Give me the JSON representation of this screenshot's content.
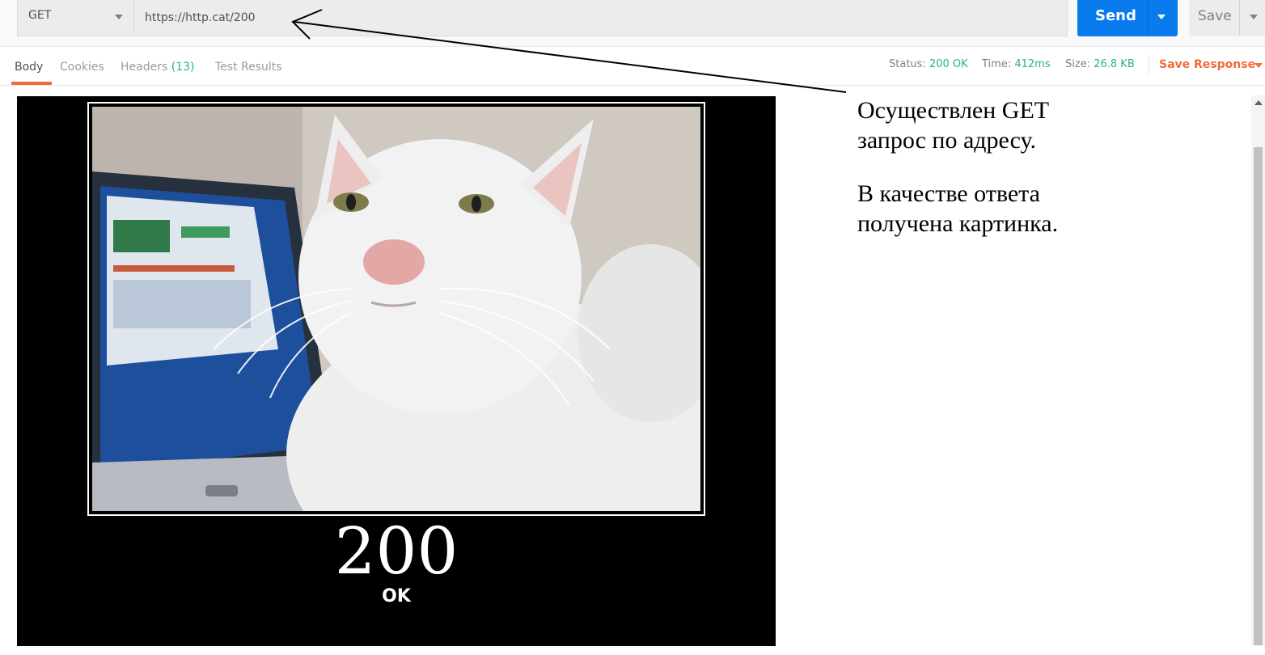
{
  "request": {
    "method": "GET",
    "url": "https://http.cat/200",
    "send_label": "Send",
    "save_label": "Save"
  },
  "tabs": [
    {
      "label": "Body",
      "active": true
    },
    {
      "label": "Cookies"
    },
    {
      "label": "Headers",
      "count": "(13)"
    },
    {
      "label": "Test Results"
    }
  ],
  "response_meta": {
    "status_label": "Status:",
    "status_value": "200 OK",
    "time_label": "Time:",
    "time_value": "412ms",
    "size_label": "Size:",
    "size_value": "26.8 KB",
    "save_response_label": "Save Response"
  },
  "poster": {
    "code": "200",
    "text": "OK"
  },
  "annotation": {
    "line1": "Осуществлен GET",
    "line2": "запрос по адресу.",
    "line3": "В качестве ответа",
    "line4": "получена картинка."
  },
  "colors": {
    "accent_blue": "#097bed",
    "accent_orange": "#f26b3a",
    "status_green": "#26b47f"
  }
}
